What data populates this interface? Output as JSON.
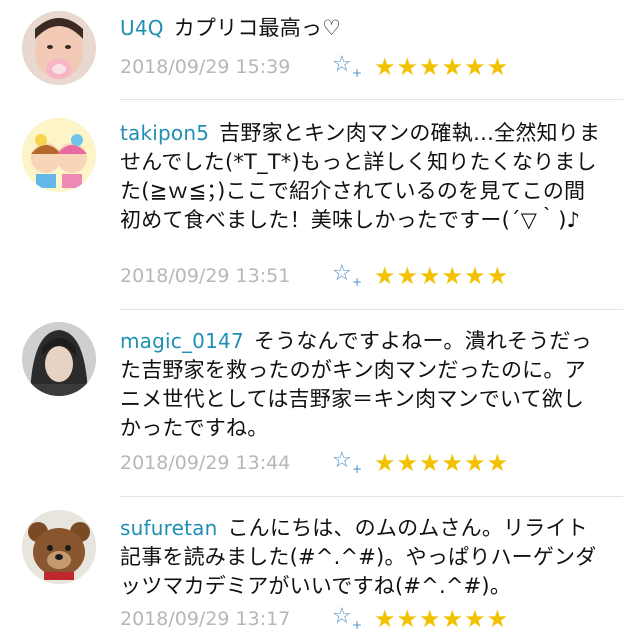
{
  "comments": [
    {
      "user": "U4Q",
      "text": "カプリコ最高っ♡",
      "timestamp": "2018/09/29 15:39",
      "star_add_icon": "star-add-icon",
      "stars": "★★★★★★"
    },
    {
      "user": "takipon5",
      "text": "吉野家とキン肉マンの確執…全然知りませんでした(*T_T*)もっと詳しく知りたくなりました(≧ｗ≦；)ここで紹介されているのを見てこの間初めて食べました！美味しかったですー(´▽｀)♪",
      "timestamp": "2018/09/29 13:51",
      "star_add_icon": "star-add-icon",
      "stars": "★★★★★★"
    },
    {
      "user": "magic_0147",
      "text": "そうなんですよねー。潰れそうだった吉野家を救ったのがキン肉マンだったのに。アニメ世代としては吉野家＝キン肉マンでいて欲しかったですね。",
      "timestamp": "2018/09/29 13:44",
      "star_add_icon": "star-add-icon",
      "stars": "★★★★★★"
    },
    {
      "user": "sufuretan",
      "text": "こんにちは、のムのムさん。リライト記事を読みました(#^.^#)。やっぱりハーゲンダッツマカデミアがいいですね(#^.^#)。",
      "timestamp": "2018/09/29 13:17",
      "star_add_icon": "star-add-icon",
      "stars": "★★★★★★"
    }
  ],
  "colors": {
    "username": "#1f8fb4",
    "timestamp": "#b7b7b7",
    "star": "#f2c100",
    "star_add": "#4b8fc9"
  }
}
